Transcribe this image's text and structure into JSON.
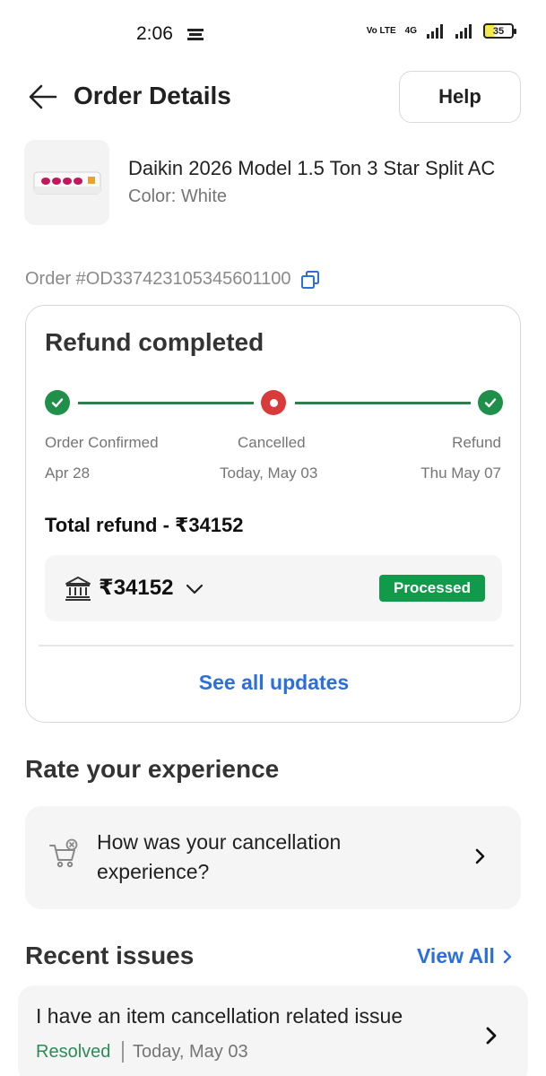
{
  "status_bar": {
    "time": "2:06",
    "network_label": "4G",
    "volte_label": "Vo LTE",
    "battery_level": "35"
  },
  "header": {
    "title": "Order Details",
    "help_label": "Help",
    "back_icon": "arrow-left-icon"
  },
  "product": {
    "name": "Daikin 2026 Model 1.5 Ton 3 Star Split AC",
    "color": "Color: White"
  },
  "order": {
    "id": "Order #OD337423105345601100",
    "copy_icon": "copy-icon"
  },
  "refund": {
    "title": "Refund completed",
    "stages": [
      {
        "label": "Order Confirmed",
        "date": "Apr 28",
        "state": "done"
      },
      {
        "label": "Cancelled",
        "date": "Today, May 03",
        "state": "cancelled"
      },
      {
        "label": "Refund",
        "date": "Thu May 07",
        "state": "done"
      }
    ],
    "total": "Total refund - ₹34152",
    "amount": "₹34152",
    "status": "Processed",
    "see_all": "See all updates"
  },
  "rate": {
    "heading": "Rate your experience",
    "question": "How was your cancellation experience?"
  },
  "recent_issues": {
    "heading": "Recent issues",
    "view_all": "View All",
    "items": [
      {
        "text": "I have an item cancellation related issue",
        "status": "Resolved",
        "date": "Today, May 03"
      }
    ]
  },
  "colors": {
    "accent_blue": "#2a6fdb",
    "success_green": "#109a4a",
    "cancel_red": "#d93a3a"
  }
}
